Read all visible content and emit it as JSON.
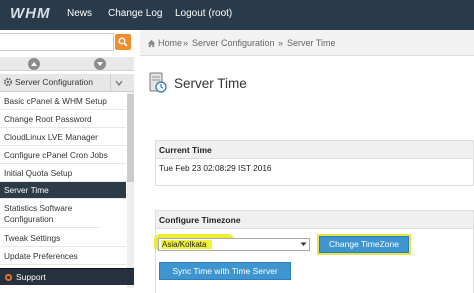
{
  "header": {
    "logo": "WHM",
    "nav": [
      "News",
      "Change Log",
      "Logout (root)"
    ]
  },
  "sidebar": {
    "section": "Server Configuration",
    "items": [
      {
        "label": "Basic cPanel & WHM Setup"
      },
      {
        "label": "Change Root Password"
      },
      {
        "label": "CloudLinux LVE Manager"
      },
      {
        "label": "Configure cPanel Cron Jobs"
      },
      {
        "label": "Initial Quota Setup"
      },
      {
        "label": "Server Time",
        "active": true
      },
      {
        "label": "Statistics Software Configuration"
      },
      {
        "label": "Tweak Settings"
      },
      {
        "label": "Update Preferences"
      }
    ],
    "support": "Support"
  },
  "breadcrumb": [
    "Home",
    "Server Configuration",
    "Server Time"
  ],
  "page": {
    "title": "Server Time"
  },
  "current_time": {
    "heading": "Current Time",
    "value": "Tue Feb 23 02:08:29 IST 2016"
  },
  "timezone": {
    "heading": "Configure Timezone",
    "selected": "Asia/Kolkata",
    "change_button": "Change TimeZone",
    "sync_button": "Sync Time with Time Server"
  },
  "colors": {
    "topbar": "#293a4a",
    "accent": "#3e95cf",
    "highlight": "#f2f23a"
  }
}
